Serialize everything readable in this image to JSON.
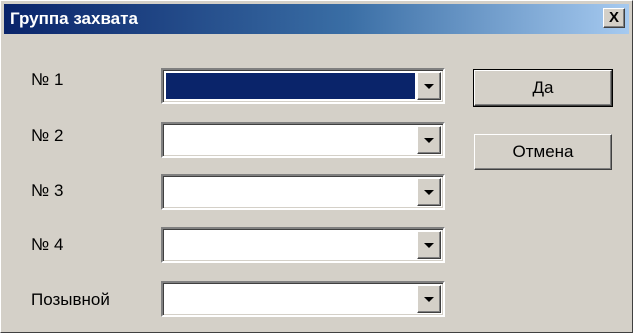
{
  "window": {
    "title": "Группа захвата",
    "close_label": "X"
  },
  "rows": [
    {
      "label": "№ 1",
      "value": "",
      "selected": true
    },
    {
      "label": "№ 2",
      "value": "",
      "selected": false
    },
    {
      "label": "№ 3",
      "value": "",
      "selected": false
    },
    {
      "label": "№ 4",
      "value": "",
      "selected": false
    },
    {
      "label": "Позывной",
      "value": "",
      "selected": false
    }
  ],
  "buttons": {
    "ok_label": "Да",
    "cancel_label": "Отмена"
  },
  "icons": {
    "close": "close-icon",
    "dropdown": "chevron-down-icon"
  },
  "colors": {
    "title_start": "#0a246a",
    "title_end": "#a6caf0",
    "selection": "#0a246a",
    "face": "#d4d0c8"
  }
}
